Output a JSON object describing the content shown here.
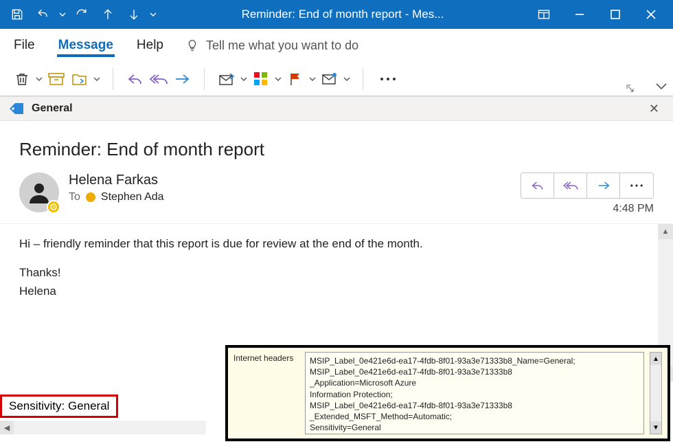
{
  "titlebar": {
    "title": "Reminder: End of month report  -  Mes..."
  },
  "menu": {
    "file": "File",
    "message": "Message",
    "help": "Help",
    "tellme": "Tell me what you want to do"
  },
  "sensitivity_bar": {
    "label": "General"
  },
  "message": {
    "subject": "Reminder: End of month report",
    "sender": "Helena Farkas",
    "to_label": "To",
    "recipient": "Stephen Ada",
    "time": "4:48 PM",
    "body_line1": "Hi – friendly reminder that this report is due for review at the end of the month.",
    "body_thanks": "Thanks!",
    "body_sig": "Helena"
  },
  "footer_sensitivity": "Sensitivity: General",
  "internet_headers": {
    "label": "Internet headers",
    "lines": [
      "MSIP_Label_0e421e6d-ea17-4fdb-8f01-93a3e71333b8_Name=General;",
      "MSIP_Label_0e421e6d-ea17-4fdb-8f01-93a3e71333b8",
      "_Application=Microsoft Azure",
      "Information Protection;",
      "MSIP_Label_0e421e6d-ea17-4fdb-8f01-93a3e71333b8",
      "_Extended_MSFT_Method=Automatic;",
      "Sensitivity=General"
    ]
  },
  "icons": {
    "save": "save",
    "undo": "undo",
    "redo": "redo",
    "up": "up",
    "down": "down",
    "popout": "popout",
    "minimize": "minimize",
    "maximize": "maximize",
    "close": "close",
    "delete": "delete",
    "archive": "archive",
    "move": "move",
    "reply": "reply",
    "replyall": "replyall",
    "forward": "forward",
    "share": "share",
    "apps": "apps",
    "flag": "flag",
    "markunread": "markunread",
    "more": "more",
    "bulb": "bulb",
    "tag": "tag"
  },
  "colors": {
    "brand": "#106ebe",
    "purple": "#8661c5",
    "blue": "#2b88d8",
    "flag": "#d83b01",
    "highlight": "#d40000"
  }
}
